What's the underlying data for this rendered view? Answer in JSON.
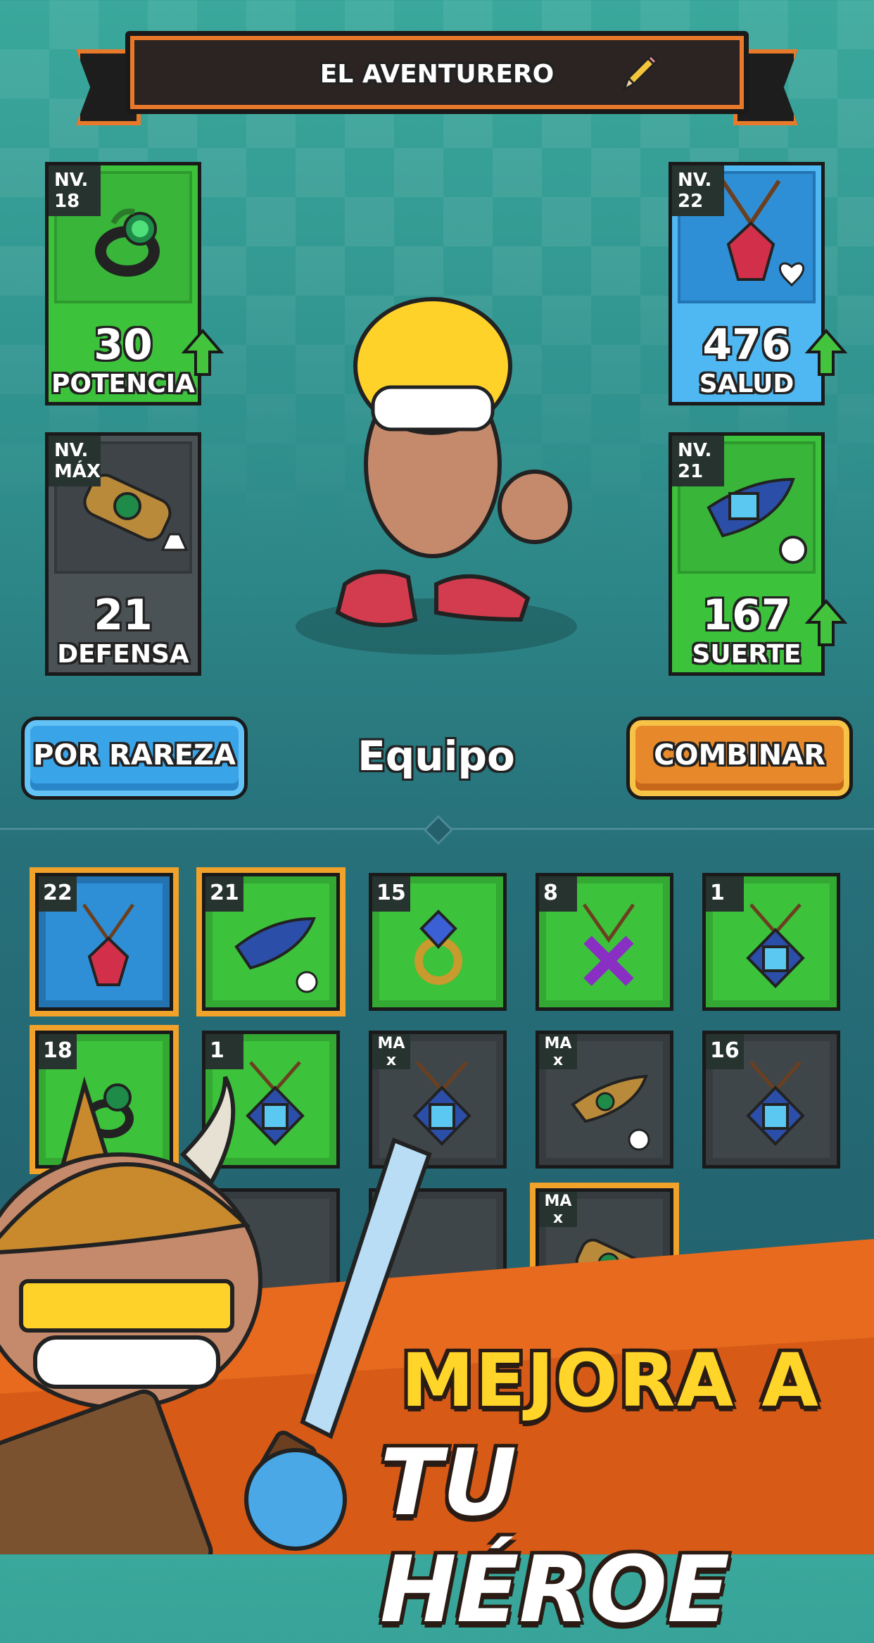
{
  "header": {
    "title": "EL AVENTURERO"
  },
  "stats": [
    {
      "level": "NV.\n18",
      "value": "30",
      "label": "POTENCIA"
    },
    {
      "level": "NV.\n22",
      "value": "476",
      "label": "SALUD"
    },
    {
      "level": "NV.\nMÁX",
      "value": "21",
      "label": "DEFENSA"
    },
    {
      "level": "NV.\n21",
      "value": "167",
      "label": "SUERTE"
    }
  ],
  "buttons": {
    "rarity": "POR RAREZA",
    "combine": "COMBINAR"
  },
  "section": {
    "title": "Equipo"
  },
  "inventory": [
    {
      "badge": "22"
    },
    {
      "badge": "21"
    },
    {
      "badge": "15"
    },
    {
      "badge": "8"
    },
    {
      "badge": "1"
    },
    {
      "badge": "18"
    },
    {
      "badge": "1"
    },
    {
      "badge": "MA\nx"
    },
    {
      "badge": "MA\nx"
    },
    {
      "badge": "16"
    },
    {
      "badge": "MA\nx"
    }
  ],
  "promo": {
    "line1": "MEJORA A",
    "line2": "TU HÉROE"
  },
  "colors": {
    "green": "#3cc23b",
    "blue": "#4fb8f2",
    "orange": "#e7892b",
    "accent": "#f0a22b"
  }
}
